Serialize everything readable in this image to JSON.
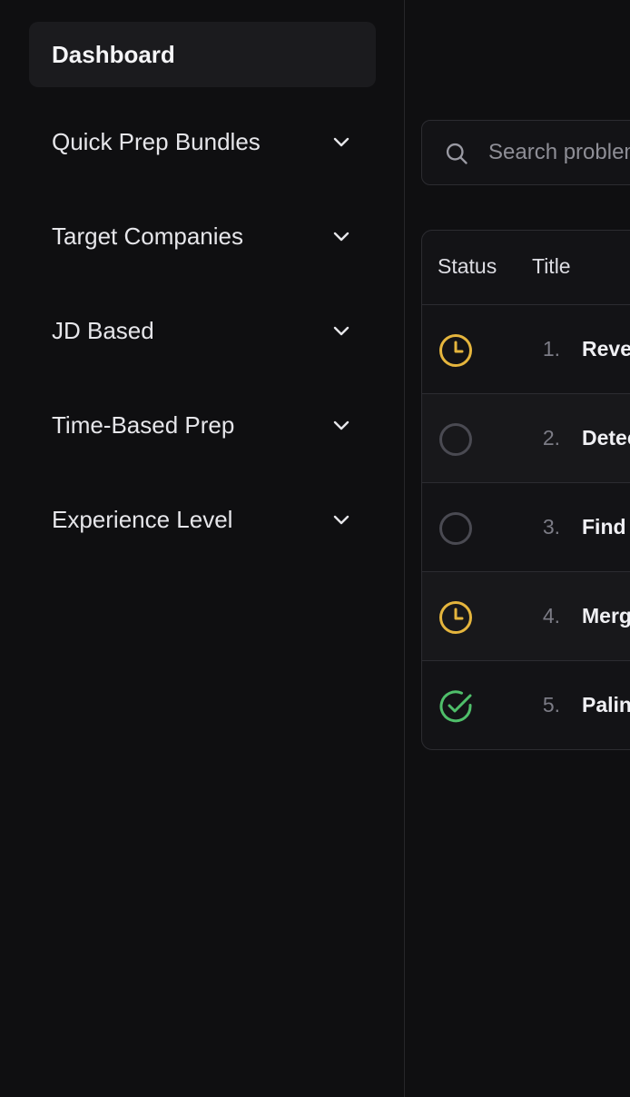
{
  "sidebar": {
    "items": [
      {
        "label": "Dashboard",
        "active": true
      },
      {
        "label": "Quick Prep Bundles"
      },
      {
        "label": "Target Companies"
      },
      {
        "label": "JD Based"
      },
      {
        "label": "Time-Based Prep"
      },
      {
        "label": "Experience Level"
      }
    ]
  },
  "search": {
    "placeholder": "Search problems"
  },
  "table": {
    "columns": [
      "Status",
      "Title"
    ],
    "rows": [
      {
        "status": "in-progress",
        "number": "1.",
        "title": "Reverse"
      },
      {
        "status": "not-started",
        "number": "2.",
        "title": "Detect"
      },
      {
        "status": "not-started",
        "number": "3.",
        "title": "Find"
      },
      {
        "status": "in-progress",
        "number": "4.",
        "title": "Merge"
      },
      {
        "status": "solved",
        "number": "5.",
        "title": "Palindrome"
      }
    ]
  },
  "colors": {
    "in_progress": "#e5b53d",
    "solved": "#4fbf6a",
    "not_started": "#4a4a52"
  }
}
